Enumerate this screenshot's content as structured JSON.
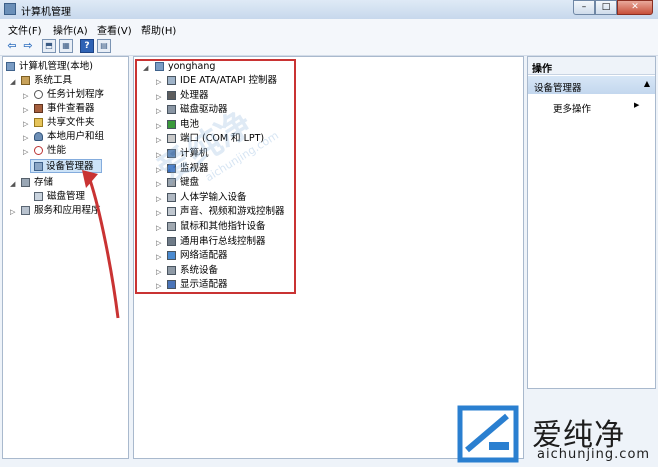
{
  "window": {
    "title": "计算机管理",
    "min": "–",
    "max": "□",
    "close": "✕"
  },
  "menu": [
    "文件(F)",
    "操作(A)",
    "查看(V)",
    "帮助(H)"
  ],
  "toolbar": {
    "back": "⇦",
    "forward": "⇨",
    "help": "?"
  },
  "left_tree": [
    {
      "label": "计算机管理(本地)",
      "expander": "",
      "icon": "computer-icon"
    },
    {
      "label": "系统工具",
      "expander": "◢",
      "icon": "tools-icon"
    },
    {
      "label": "任务计划程序",
      "expander": "▷",
      "icon": "clock-icon"
    },
    {
      "label": "事件查看器",
      "expander": "▷",
      "icon": "event-viewer-icon"
    },
    {
      "label": "共享文件夹",
      "expander": "▷",
      "icon": "shared-folder-icon"
    },
    {
      "label": "本地用户和组",
      "expander": "▷",
      "icon": "users-icon"
    },
    {
      "label": "性能",
      "expander": "▷",
      "icon": "performance-icon"
    },
    {
      "label": "设备管理器",
      "expander": "",
      "icon": "device-manager-icon",
      "selected": true
    },
    {
      "label": "存储",
      "expander": "◢",
      "icon": "storage-icon"
    },
    {
      "label": "磁盘管理",
      "expander": "",
      "icon": "disk-icon"
    },
    {
      "label": "服务和应用程序",
      "expander": "▷",
      "icon": "services-icon"
    }
  ],
  "device_tree": {
    "root": "yonghang",
    "items": [
      "IDE ATA/ATAPI 控制器",
      "处理器",
      "磁盘驱动器",
      "电池",
      "端口 (COM 和 LPT)",
      "计算机",
      "监视器",
      "键盘",
      "人体学输入设备",
      "声音、视频和游戏控制器",
      "鼠标和其他指针设备",
      "通用串行总线控制器",
      "网络适配器",
      "系统设备",
      "显示适配器"
    ]
  },
  "actions": {
    "header": "操作",
    "section": "设备管理器",
    "more": "更多操作",
    "caret": "▲",
    "more_arrow": "▶"
  },
  "watermark": {
    "text": "爱纯净",
    "url": "aichunjing.com"
  },
  "brand": {
    "name": "爱纯净",
    "url": "aichunjing.com"
  },
  "colors": {
    "annotation_red": "#c93333",
    "selection": "#cde3f7",
    "accent": "#2f6fbf"
  }
}
